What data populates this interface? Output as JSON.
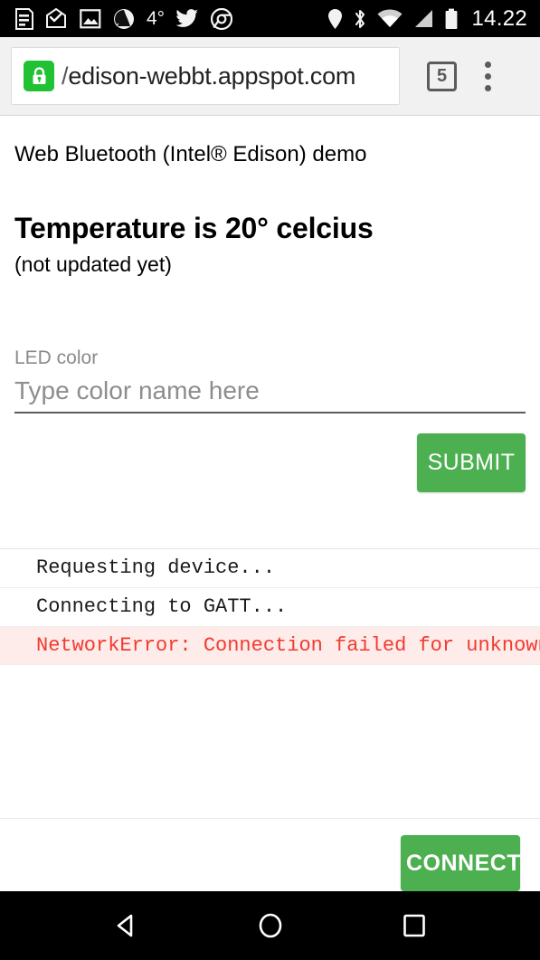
{
  "statusbar": {
    "left_icons": [
      {
        "name": "news-article-icon"
      },
      {
        "name": "mail-open-icon"
      },
      {
        "name": "photo-image-icon"
      },
      {
        "name": "moves-app-icon"
      },
      {
        "name": "weather-temperature-icon"
      },
      {
        "name": "twitter-bird-icon"
      },
      {
        "name": "chrome-browser-icon"
      }
    ],
    "weather_temp": "4°",
    "right_icons": [
      {
        "name": "location-pin-icon"
      },
      {
        "name": "bluetooth-icon"
      },
      {
        "name": "wifi-icon"
      },
      {
        "name": "cellular-signal-icon"
      },
      {
        "name": "battery-icon"
      }
    ],
    "clock": "14.22"
  },
  "browser": {
    "url_prefix": "/",
    "url": "edison-webbt.appspot.com",
    "security_icon": "lock-icon",
    "security_color": "#20c233",
    "tab_count": "5",
    "menu_icon": "overflow-menu-icon"
  },
  "page": {
    "title": "Web Bluetooth (Intel® Edison) demo",
    "temperature_heading": "Temperature is 20° celcius",
    "temperature_status": "(not updated yet)",
    "form": {
      "led_color_label": "LED color",
      "led_color_value": "",
      "led_color_placeholder": "Type color name here",
      "submit_label": "SUBMIT"
    },
    "log": [
      {
        "text": "Requesting device...",
        "type": "info"
      },
      {
        "text": "Connecting to GATT...",
        "type": "info"
      },
      {
        "text": "NetworkError: Connection failed for unknown",
        "type": "error"
      }
    ],
    "connect_label": "CONNECT",
    "accent_color": "#4caf50",
    "error_color": "#f23a2f",
    "error_background": "#fdecea"
  },
  "navbar": {
    "back": "back-button",
    "home": "home-button",
    "recents": "recents-button"
  }
}
